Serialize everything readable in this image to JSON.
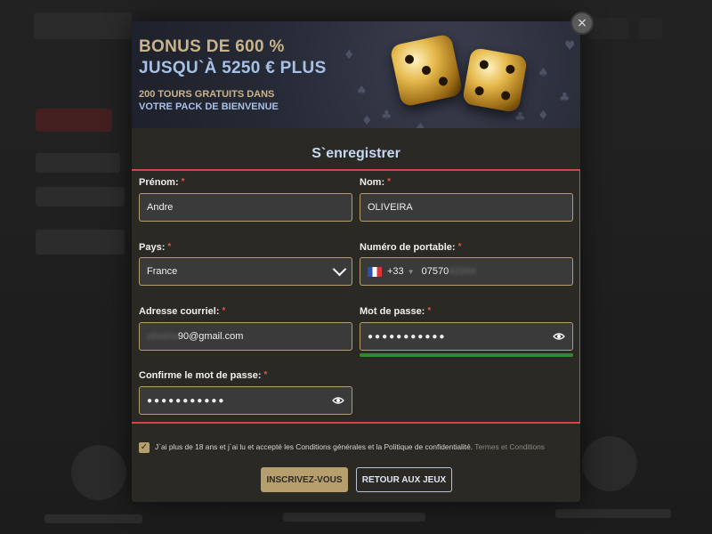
{
  "banner": {
    "title_line1": "BONUS DE 600 %",
    "title_line2": "JUSQU`À 5250 € PLUS",
    "sub_line1": "200 TOURS GRATUITS DANS",
    "sub_line2": "VOTRE PACK DE BIENVENUE"
  },
  "close_icon": "×",
  "form": {
    "title": "S`enregistrer",
    "required_mark": "*",
    "first_name": {
      "label": "Prénom:",
      "value": "Andre"
    },
    "last_name": {
      "label": "Nom:",
      "value": "OLIVEIRA"
    },
    "country": {
      "label": "Pays:",
      "value": "France"
    },
    "phone": {
      "label": "Numéro de portable:",
      "code": "+33",
      "number_visible": "07570",
      "number_blurred": "62944",
      "flag_icon": "france-flag-icon"
    },
    "email": {
      "label": "Adresse courriel:",
      "blurred": "oliveira",
      "value": "90@gmail.com"
    },
    "password": {
      "label": "Mot de passe:",
      "masked": "●●●●●●●●●●●",
      "strength_color": "#2e8b2e"
    },
    "confirm_password": {
      "label": "Confirme le mot de passe:",
      "masked": "●●●●●●●●●●●"
    }
  },
  "terms": {
    "text": "J`ai plus de 18 ans et j`ai lu et accepté les Conditions générales et la Politique de confidentialité.",
    "link": "Termes et Conditions",
    "checked": true
  },
  "buttons": {
    "register": "INSCRIVEZ-VOUS",
    "back": "RETOUR AUX JEUX"
  },
  "colors": {
    "accent_gold": "#b69e6d",
    "highlight_red": "#d0464a",
    "modal_bg": "#2b2924"
  }
}
